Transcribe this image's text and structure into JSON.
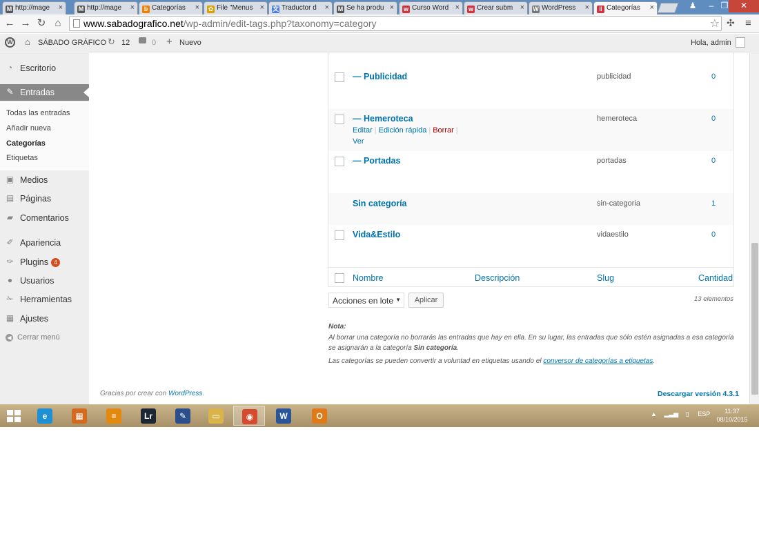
{
  "browser": {
    "tabs": [
      {
        "title": "http://mage",
        "favicon": "M",
        "color": "#555"
      },
      {
        "title": "http://mage",
        "favicon": "M",
        "color": "#555"
      },
      {
        "title": "Categorías",
        "favicon": "b",
        "color": "#f57d00"
      },
      {
        "title": "File \"Menus",
        "favicon": "✿",
        "color": "#d8a200"
      },
      {
        "title": "Traductor d",
        "favicon": "文",
        "color": "#4a7ee0"
      },
      {
        "title": "Se ha produ",
        "favicon": "M",
        "color": "#555"
      },
      {
        "title": "Curso Word",
        "favicon": "w",
        "color": "#d0343f"
      },
      {
        "title": "Crear subm",
        "favicon": "w",
        "color": "#d0343f"
      },
      {
        "title": "WordPress",
        "favicon": "W",
        "color": "#777"
      },
      {
        "title": "Categorías",
        "favicon": "‖",
        "color": "#d0343f"
      }
    ],
    "url_host": "www.sabadografico.net",
    "url_path": "/wp-admin/edit-tags.php?taxonomy=category"
  },
  "adminbar": {
    "site_name": "SÁBADO GRÁFICO",
    "updates_count": "12",
    "comments_count": "0",
    "new_label": "Nuevo",
    "howdy": "Hola, admin"
  },
  "sidebar": {
    "escritorio": "Escritorio",
    "entradas": "Entradas",
    "submenu": {
      "todas": "Todas las entradas",
      "anadir": "Añadir nueva",
      "categorias": "Categorías",
      "etiquetas": "Etiquetas"
    },
    "medios": "Medios",
    "paginas": "Páginas",
    "comentarios": "Comentarios",
    "apariencia": "Apariencia",
    "plugins": "Plugins",
    "plugins_badge": "4",
    "usuarios": "Usuarios",
    "herramientas": "Herramientas",
    "ajustes": "Ajustes",
    "cerrar": "Cerrar menú"
  },
  "table": {
    "rows": [
      {
        "name": "— Publicidad",
        "slug": "publicidad",
        "count": "0"
      },
      {
        "name": "— Hemeroteca",
        "slug": "hemeroteca",
        "count": "0"
      },
      {
        "name": "— Portadas",
        "slug": "portadas",
        "count": "0"
      },
      {
        "name": "Sin categoría",
        "slug": "sin-categoria",
        "count": "1"
      },
      {
        "name": "Vida&Estilo",
        "slug": "vidaestilo",
        "count": "0"
      }
    ],
    "row_actions": {
      "edit": "Editar",
      "quick_edit": "Edición rápida",
      "delete": "Borrar",
      "view": "Ver"
    },
    "columns": {
      "name": "Nombre",
      "description": "Descripción",
      "slug": "Slug",
      "count": "Cantidad"
    }
  },
  "bulk": {
    "select_value": "Acciones en lote",
    "apply": "Aplicar",
    "items_count": "13 elementos"
  },
  "note": {
    "title": "Nota:",
    "line1_a": "Al borrar una categoría no borrarás las entradas que hay en ella. En su lugar, las entradas que sólo estén asignadas a esa categoría se asignarán a la categoría ",
    "line1_b": "Sin categoría",
    "line1_c": ".",
    "line2_a": "Las categorías se pueden convertir a voluntad en etiquetas usando el ",
    "line2_link": "conversor de categorías a etiquetas",
    "line2_c": "."
  },
  "footer": {
    "thanks_a": "Gracias por crear con ",
    "thanks_link": "WordPress",
    "thanks_c": ".",
    "version": "Descargar versión 4.3.1"
  },
  "taskbar": {
    "lang": "ESP",
    "time": "11:37",
    "date": "08/10/2015",
    "apps": [
      {
        "name": "ie-icon",
        "glyph": "e",
        "color": "#1e90d6"
      },
      {
        "name": "store-icon",
        "glyph": "▦",
        "color": "#d46a1e"
      },
      {
        "name": "notes-icon",
        "glyph": "≡",
        "color": "#e28a10"
      },
      {
        "name": "lightroom-icon",
        "glyph": "Lr",
        "color": "#1d2733"
      },
      {
        "name": "pen-icon",
        "glyph": "✎",
        "color": "#2b4f8a"
      },
      {
        "name": "explorer-icon",
        "glyph": "▭",
        "color": "#d9b44a"
      },
      {
        "name": "chrome-icon",
        "glyph": "◉",
        "color": "#d64a2f"
      },
      {
        "name": "word-icon",
        "glyph": "W",
        "color": "#2a5699"
      },
      {
        "name": "outlook-icon",
        "glyph": "O",
        "color": "#e07a18"
      }
    ]
  }
}
